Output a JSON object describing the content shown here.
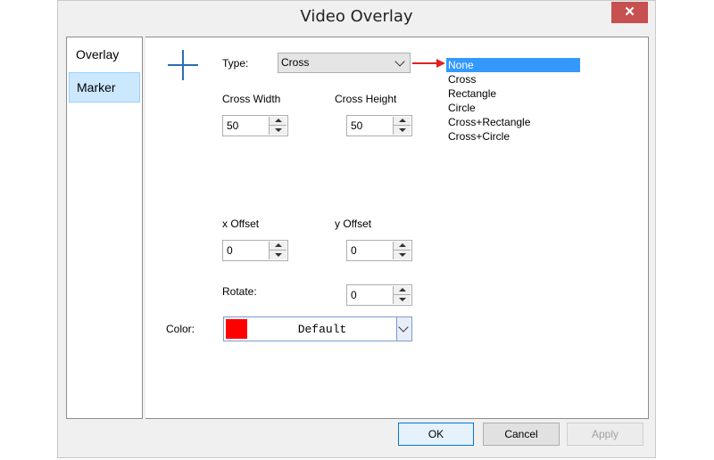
{
  "window": {
    "title": "Video Overlay",
    "close_glyph": "✕"
  },
  "sidebar": {
    "items": [
      {
        "label": "Overlay"
      },
      {
        "label": "Marker"
      }
    ]
  },
  "marker": {
    "type_label": "Type:",
    "type_value": "Cross",
    "dropdown_options": [
      "None",
      "Cross",
      "Rectangle",
      "Circle",
      "Cross+Rectangle",
      "Cross+Circle"
    ],
    "highlighted_option": "None",
    "cross_width_label": "Cross Width",
    "cross_width_value": "50",
    "cross_height_label": "Cross Height",
    "cross_height_value": "50",
    "x_offset_label": "x Offset",
    "x_offset_value": "0",
    "y_offset_label": "y Offset",
    "y_offset_value": "0",
    "rotate_label": "Rotate:",
    "rotate_value": "0",
    "color_label": "Color:",
    "color_value": "Default",
    "color_swatch": "#ff0000",
    "marker_preview_icon": "cross-icon",
    "accent_color": "#2a6db5",
    "arrow_color": "#e02020"
  },
  "buttons": {
    "ok": "OK",
    "cancel": "Cancel",
    "apply": "Apply"
  }
}
